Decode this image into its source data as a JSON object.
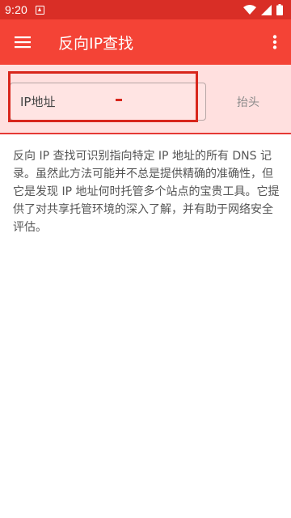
{
  "status_bar": {
    "time": "9:20"
  },
  "app_bar": {
    "title": "反向IP查找"
  },
  "search": {
    "placeholder": "IP地址",
    "button_label": "抬头"
  },
  "description": "反向 IP 查找可识别指向特定 IP 地址的所有 DNS 记录。虽然此方法可能并不总是提供精确的准确性，但它是发现 IP 地址何时托管多个站点的宝贵工具。它提供了对共享托管环境的深入了解，并有助于网络安全评估。",
  "colors": {
    "status_bar": "#d92e26",
    "app_bar": "#f44336",
    "search_area": "#ffe0df",
    "highlight": "#d8261c"
  }
}
